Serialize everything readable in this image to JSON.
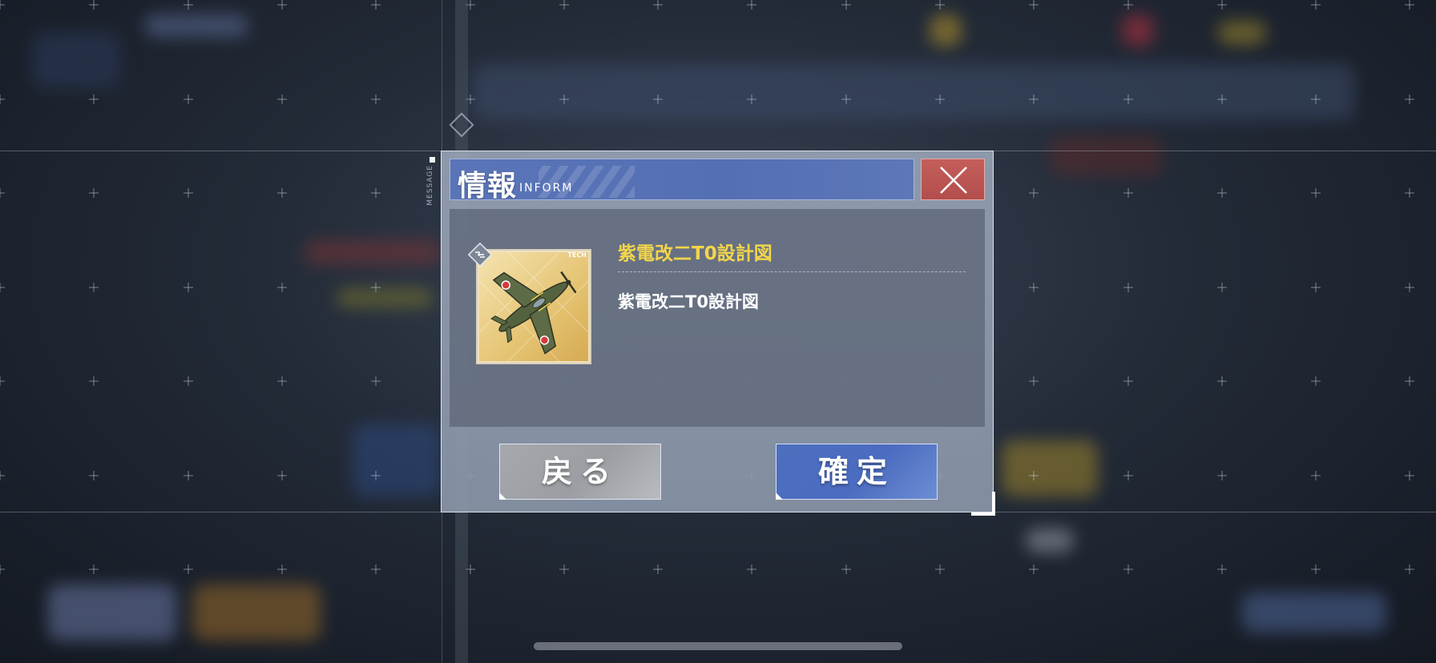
{
  "dialog": {
    "title_jp": "情報",
    "title_en": "INFORM",
    "close_icon": "close-icon"
  },
  "side_label": "MESSAGE",
  "item": {
    "badge": "TECH",
    "name": "紫電改二T0設計図",
    "description": "紫電改二T0設計図",
    "icon": "plane-blueprint-icon"
  },
  "buttons": {
    "back_label": "戻る",
    "confirm_label": "確定"
  },
  "colors": {
    "title_bar": "#5470b3",
    "close": "#b24e4c",
    "item_name": "#f3d54a",
    "confirm": "#4b6cc0",
    "back": "#9b9ea3"
  }
}
